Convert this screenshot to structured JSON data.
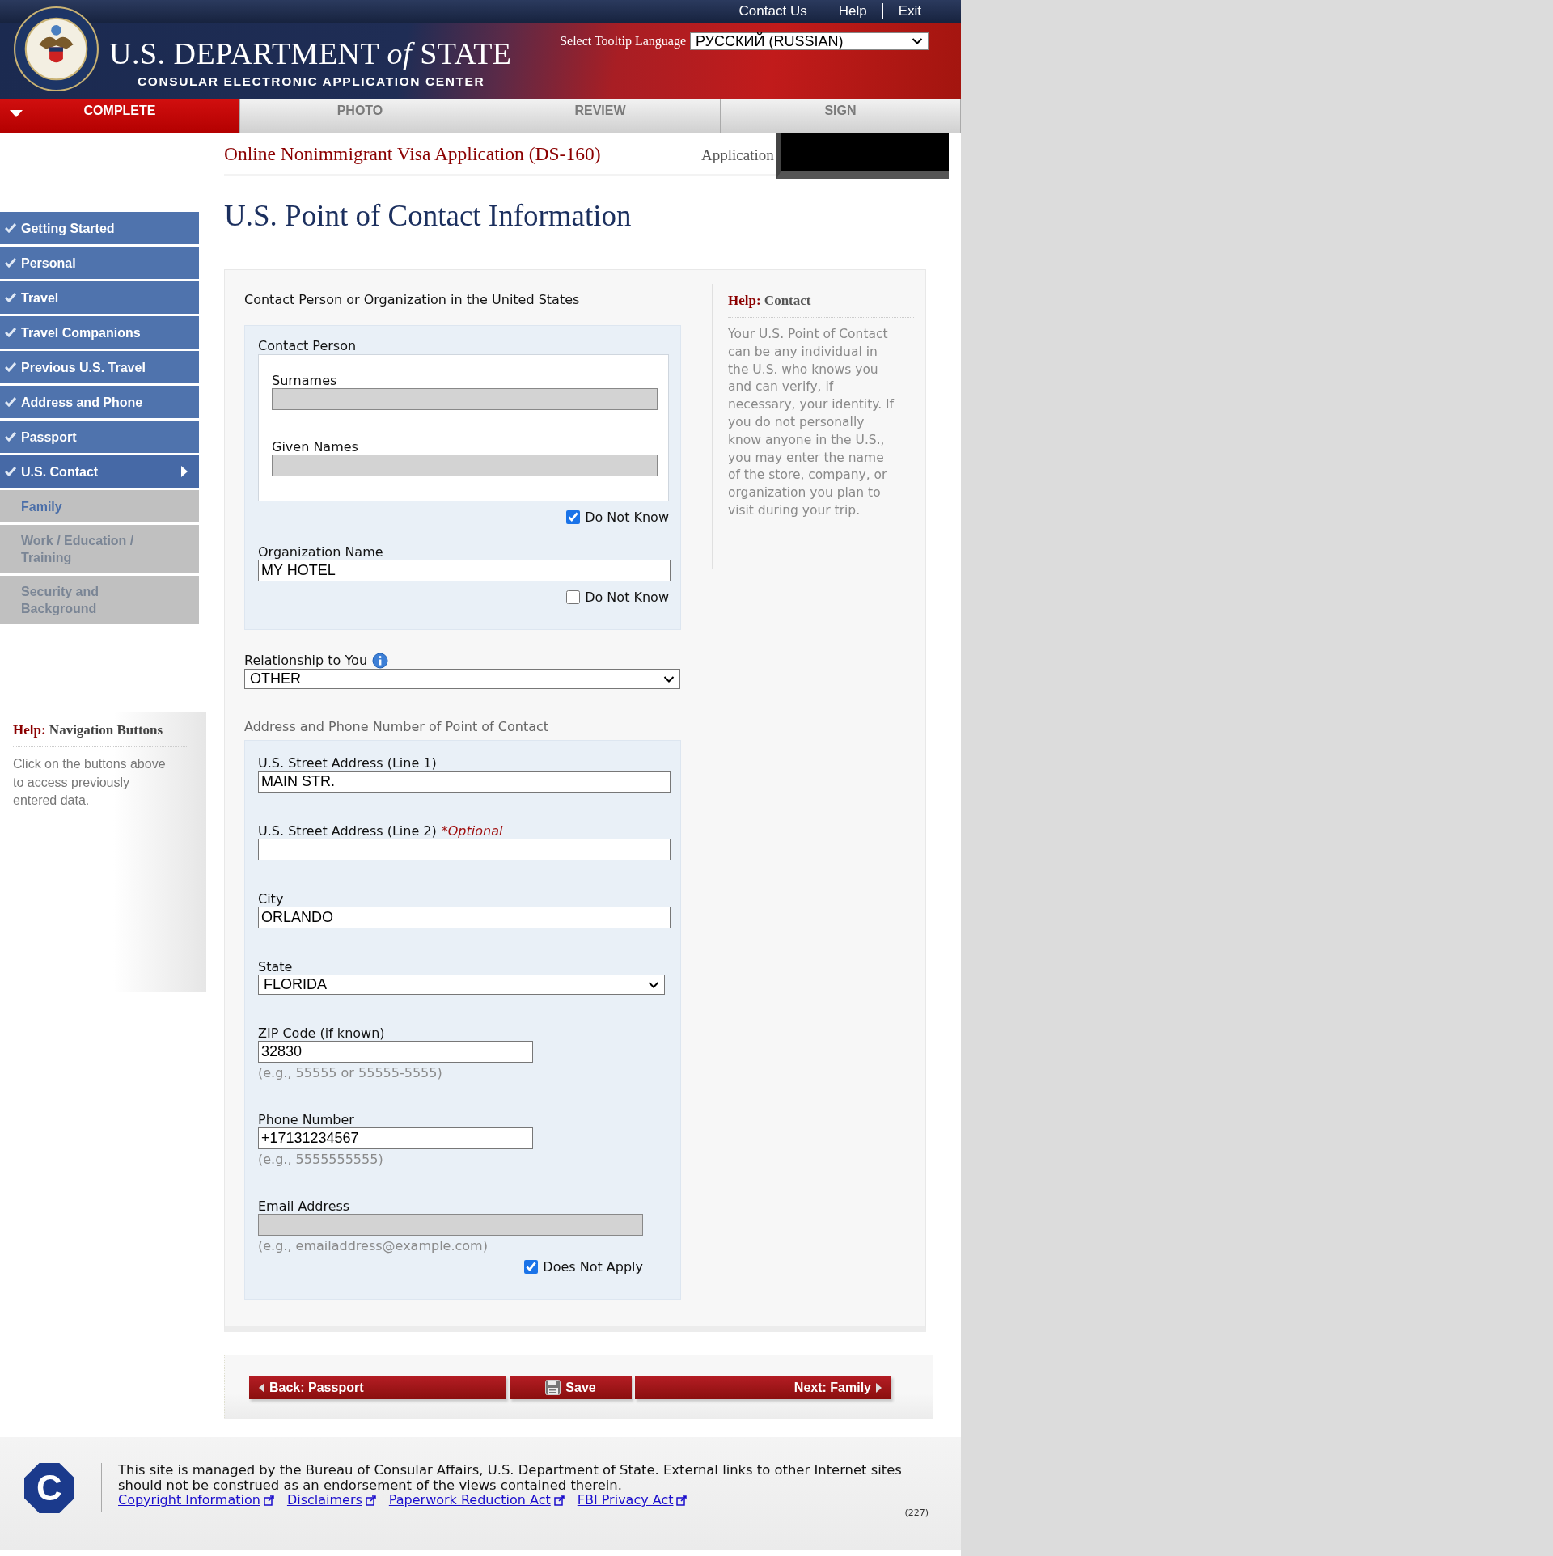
{
  "top_links": [
    "Contact Us",
    "Help",
    "Exit"
  ],
  "header": {
    "title": "U.S. DEPARTMENT *of* STATE",
    "subtitle": "CONSULAR ELECTRONIC APPLICATION CENTER",
    "language_label": "Select Tooltip Language",
    "language_value": "РУССКИЙ (RUSSIAN)"
  },
  "steps": [
    {
      "label": "COMPLETE",
      "selected": true
    },
    {
      "label": "PHOTO",
      "selected": false
    },
    {
      "label": "REVIEW",
      "selected": false
    },
    {
      "label": "SIGN",
      "selected": false
    }
  ],
  "app_title": "Online Nonimmigrant Visa Application (DS-160)",
  "application_label": "Application",
  "sidebar": {
    "items": [
      {
        "label": "Getting Started",
        "kind": "done",
        "selected": false
      },
      {
        "label": "Personal",
        "kind": "done",
        "selected": false
      },
      {
        "label": "Travel",
        "kind": "done",
        "selected": false
      },
      {
        "label": "Travel Companions",
        "kind": "done",
        "selected": false
      },
      {
        "label": "Previous U.S. Travel",
        "kind": "done",
        "selected": false
      },
      {
        "label": "Address and Phone",
        "kind": "done",
        "selected": false
      },
      {
        "label": "Passport",
        "kind": "done",
        "selected": false
      },
      {
        "label": "U.S. Contact",
        "kind": "done",
        "selected": true
      },
      {
        "label": "Family",
        "kind": "next",
        "selected": false
      },
      {
        "label": "Work / Education / Training",
        "kind": "locked",
        "selected": false
      },
      {
        "label": "Security and Background",
        "kind": "locked",
        "selected": false
      }
    ],
    "help": {
      "title": "Help:",
      "topic": "Navigation Buttons",
      "text": "Click on the buttons above to access previously entered data."
    }
  },
  "page_heading": "U.S. Point of Contact Information",
  "form": {
    "section_title": "Contact Person or Organization in the United States",
    "contact_person": {
      "title": "Contact Person",
      "fields": [
        {
          "label": "Surnames",
          "disabled": true
        },
        {
          "label": "Given Names",
          "disabled": true
        }
      ],
      "do_not_know": {
        "label": "Do Not Know",
        "checked": true
      }
    },
    "organization": {
      "label": "Organization Name",
      "value": "MY HOTEL",
      "do_not_know": {
        "label": "Do Not Know",
        "checked": false
      }
    },
    "relationship": {
      "label": "Relationship to You",
      "value": "OTHER"
    },
    "address_title": "Address and Phone Number of Point of Contact",
    "address_fields": [
      {
        "kind": "text",
        "label": "U.S. Street Address (Line 1)",
        "value": "MAIN STR."
      },
      {
        "kind": "text",
        "label": "U.S. Street Address (Line 2)",
        "optional": "*Optional"
      },
      {
        "kind": "text",
        "label": "City",
        "value": "ORLANDO"
      },
      {
        "kind": "select",
        "label": "State",
        "value": "FLORIDA"
      },
      {
        "kind": "short",
        "label": "ZIP Code (if known)",
        "value": "32830",
        "hint": "(e.g., 55555 or 55555-5555)"
      },
      {
        "kind": "short",
        "label": "Phone Number",
        "value": "+17131234567",
        "hint": "(e.g., 5555555555)"
      },
      {
        "kind": "email",
        "label": "Email Address",
        "disabled": true,
        "hint": "(e.g., emailaddress@example.com)",
        "does_not_apply": {
          "label": "Does Not Apply",
          "checked": true
        }
      }
    ]
  },
  "help": {
    "title": "Help:",
    "topic": "Contact",
    "text": "Your U.S. Point of Contact can be any individual in the U.S. who knows you and can verify, if necessary, your identity. If you do not personally know anyone in the U.S., you may enter the name of the store, company, or organization you plan to visit during your trip."
  },
  "buttons": [
    {
      "label": "Back: Passport",
      "kind": "back"
    },
    {
      "label": "Save",
      "kind": "save"
    },
    {
      "label": "Next: Family",
      "kind": "next"
    }
  ],
  "footer": {
    "logo_letter": "C",
    "text": "This site is managed by the Bureau of Consular Affairs, U.S. Department of State. External links to other Internet sites should not be construed as an endorsement of the views contained therein.",
    "links": [
      "Copyright Information",
      "Disclaimers",
      "Paperwork Reduction Act",
      "FBI Privacy Act"
    ],
    "code": "(227)"
  }
}
